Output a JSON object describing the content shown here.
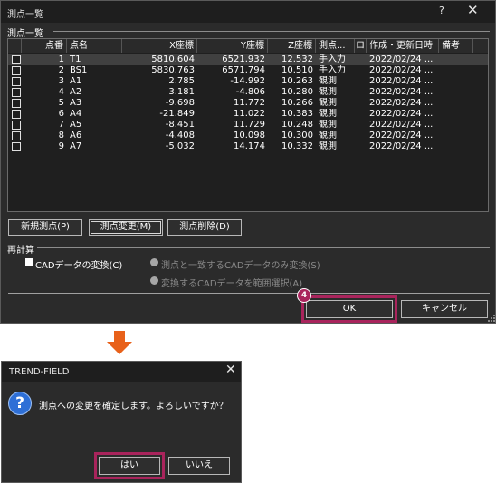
{
  "main_dialog": {
    "title": "測点一覧",
    "help_glyph": "?",
    "close_glyph": "✕",
    "group_points": "測点一覧",
    "columns": [
      "点番",
      "点名",
      "X座標",
      "Y座標",
      "Z座標",
      "測点...",
      "ロ",
      "作成・更新日時",
      "備考"
    ],
    "rows": [
      [
        "1",
        "T1",
        "5810.604",
        "6521.932",
        "12.532",
        "手入力",
        "",
        "2022/02/24 ...",
        ""
      ],
      [
        "2",
        "BS1",
        "5830.763",
        "6571.794",
        "10.510",
        "手入力",
        "",
        "2022/02/24 ...",
        ""
      ],
      [
        "3",
        "A1",
        "2.785",
        "-14.992",
        "10.263",
        "観測",
        "",
        "2022/02/24 ...",
        ""
      ],
      [
        "4",
        "A2",
        "3.181",
        "-4.806",
        "10.280",
        "観測",
        "",
        "2022/02/24 ...",
        ""
      ],
      [
        "5",
        "A3",
        "-9.698",
        "11.772",
        "10.266",
        "観測",
        "",
        "2022/02/24 ...",
        ""
      ],
      [
        "6",
        "A4",
        "-21.849",
        "11.022",
        "10.383",
        "観測",
        "",
        "2022/02/24 ...",
        ""
      ],
      [
        "7",
        "A5",
        "-8.451",
        "11.729",
        "10.248",
        "観測",
        "",
        "2022/02/24 ...",
        ""
      ],
      [
        "8",
        "A6",
        "-4.408",
        "10.098",
        "10.300",
        "観測",
        "",
        "2022/02/24 ...",
        ""
      ],
      [
        "9",
        "A7",
        "-5.032",
        "14.174",
        "10.332",
        "観測",
        "",
        "2022/02/24 ...",
        ""
      ]
    ],
    "btn_new": "新規測点(P)",
    "btn_change": "測点変更(M)",
    "btn_delete": "測点削除(D)",
    "group_recalc": "再計算",
    "cad_convert": "CADデータの変換(C)",
    "radio_match": "測点と一致するCADデータのみ変換(S)",
    "radio_range": "変換するCADデータを範囲選択(A)",
    "btn_ok": "OK",
    "btn_cancel": "キャンセル",
    "step_badge": "4"
  },
  "confirm_dialog": {
    "title": "TREND-FIELD",
    "close_glyph": "✕",
    "icon_glyph": "?",
    "message": "測点への変更を確定します。よろしいですか？",
    "btn_yes": "はい",
    "btn_no": "いいえ"
  },
  "colors": {
    "highlight": "#a9245c",
    "dialog_bg": "#2b2b2b",
    "question_icon": "#2e6fd6",
    "arrow": "#e8611a"
  }
}
